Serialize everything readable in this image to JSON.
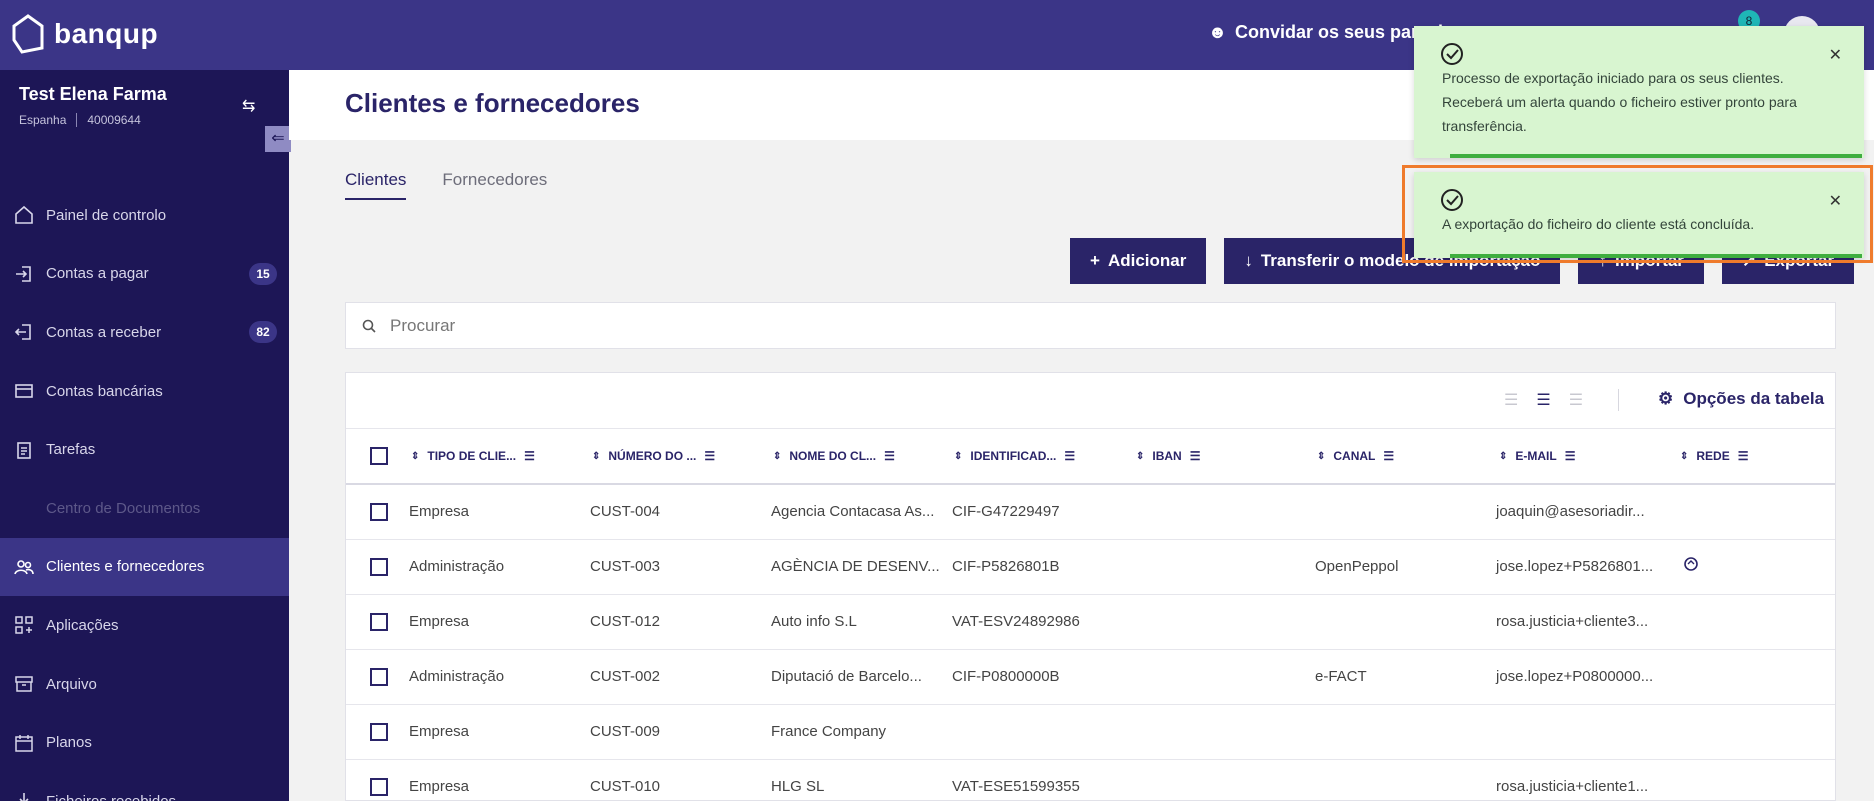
{
  "app": {
    "logo_text": "banqup",
    "invite_label": "Convidar os seus parceiros",
    "notification_count": "8"
  },
  "company": {
    "name": "Test Elena Farma",
    "country": "Espanha",
    "id": "40009644"
  },
  "sidebar": {
    "items": [
      {
        "label": "Painel de controlo",
        "icon": "home-icon"
      },
      {
        "label": "Contas a pagar",
        "icon": "inbound-icon",
        "badge": "15"
      },
      {
        "label": "Contas a receber",
        "icon": "outbound-icon",
        "badge": "82"
      },
      {
        "label": "Contas bancárias",
        "icon": "bank-card-icon"
      },
      {
        "label": "Tarefas",
        "icon": "clipboard-icon"
      },
      {
        "label": "Centro de Documentos",
        "icon": "",
        "disabled": true
      },
      {
        "label": "Clientes e fornecedores",
        "icon": "people-icon",
        "active": true
      },
      {
        "label": "Aplicações",
        "icon": "apps-icon"
      },
      {
        "label": "Arquivo",
        "icon": "archive-icon"
      },
      {
        "label": "Planos",
        "icon": "calendar-icon"
      },
      {
        "label": "Ficheiros recebidos",
        "icon": "download-icon"
      }
    ]
  },
  "page": {
    "title": "Clientes e fornecedores"
  },
  "tabs": [
    {
      "label": "Clientes",
      "active": true
    },
    {
      "label": "Fornecedores"
    }
  ],
  "actions": {
    "add": "Adicionar",
    "download_template": "Transferir o modelo de importação",
    "import": "Importar",
    "export": "Exportar"
  },
  "search": {
    "placeholder": "Procurar"
  },
  "table": {
    "options_label": "Opções da tabela",
    "columns": [
      "TIPO DE CLIE...",
      "NÚMERO DO ...",
      "NOME DO CL...",
      "IDENTIFICAD...",
      "IBAN",
      "CANAL",
      "E-MAIL",
      "REDE"
    ],
    "rows": [
      {
        "tipo": "Empresa",
        "numero": "CUST-004",
        "nome": "Agencia Contacasa As...",
        "ident": "CIF-G47229497",
        "iban": "",
        "canal": "",
        "email": "joaquin@asesoriadir...",
        "rede": ""
      },
      {
        "tipo": "Administração",
        "numero": "CUST-003",
        "nome": "AGÈNCIA DE DESENV...",
        "ident": "CIF-P5826801B",
        "iban": "",
        "canal": "OpenPeppol",
        "email": "jose.lopez+P5826801...",
        "rede": "network-icon"
      },
      {
        "tipo": "Empresa",
        "numero": "CUST-012",
        "nome": "Auto info S.L",
        "ident": "VAT-ESV24892986",
        "iban": "",
        "canal": "",
        "email": "rosa.justicia+cliente3...",
        "rede": ""
      },
      {
        "tipo": "Administração",
        "numero": "CUST-002",
        "nome": "Diputació de Barcelo...",
        "ident": "CIF-P0800000B",
        "iban": "",
        "canal": "e-FACT",
        "email": "jose.lopez+P0800000...",
        "rede": ""
      },
      {
        "tipo": "Empresa",
        "numero": "CUST-009",
        "nome": "France Company",
        "ident": "",
        "iban": "",
        "canal": "",
        "email": "",
        "rede": ""
      },
      {
        "tipo": "Empresa",
        "numero": "CUST-010",
        "nome": "HLG SL",
        "ident": "VAT-ESE51599355",
        "iban": "",
        "canal": "",
        "email": "rosa.justicia+cliente1...",
        "rede": ""
      }
    ]
  },
  "toasts": [
    {
      "message_lines": [
        "Processo de exportação iniciado para os seus clientes.",
        "Receberá um alerta quando o ficheiro estiver pronto para",
        "transferência."
      ]
    },
    {
      "message_lines": [
        "A exportação do ficheiro do cliente está concluída."
      ]
    }
  ],
  "colors": {
    "brand": "#3b3587",
    "sidebar": "#1d1656",
    "toast_bg": "#d8f5d0",
    "highlight": "#ef7b2c"
  }
}
